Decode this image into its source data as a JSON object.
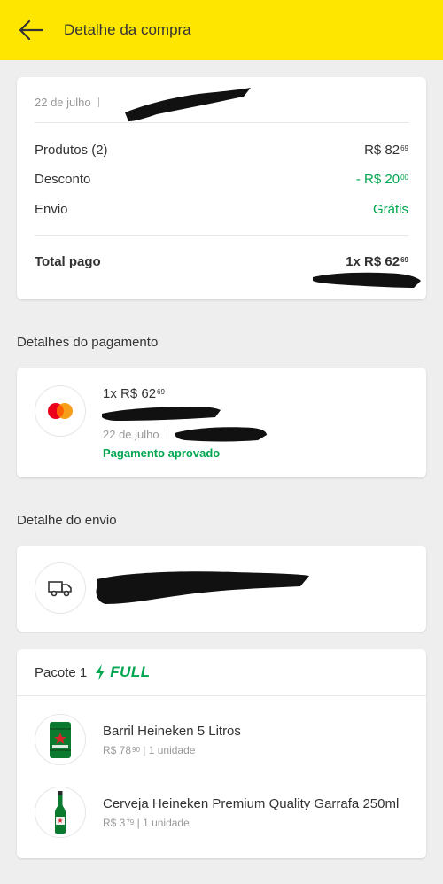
{
  "header": {
    "title": "Detalhe da compra",
    "back_icon": "arrow-left-icon"
  },
  "summary": {
    "date": "22 de julho",
    "rows": [
      {
        "label": "Produtos (2)",
        "amount": "R$ 82",
        "cents": "69"
      },
      {
        "label": "Desconto",
        "amount": "- R$ 20",
        "cents": "00"
      },
      {
        "label": "Envio",
        "amount": "Grátis",
        "cents": ""
      }
    ],
    "total_label": "Total pago",
    "total_amount": "1x R$ 62",
    "total_cents": "69"
  },
  "payment": {
    "section_title": "Detalhes do pagamento",
    "amount": "1x R$ 62",
    "cents": "69",
    "date": "22 de julho",
    "status": "Pagamento aprovado",
    "icon": "mastercard-icon"
  },
  "shipping": {
    "section_title": "Detalhe do envio",
    "icon": "truck-icon"
  },
  "package": {
    "title": "Pacote 1",
    "badge": "FULL",
    "items": [
      {
        "name": "Barril Heineken 5 Litros",
        "price": "R$ 78",
        "cents": "90",
        "qty": "1 unidade",
        "icon": "keg-icon"
      },
      {
        "name": "Cerveja Heineken Premium Quality Garrafa 250ml",
        "price": "R$ 3",
        "cents": "79",
        "qty": "1 unidade",
        "icon": "bottle-icon"
      }
    ]
  },
  "colors": {
    "header": "#ffe600",
    "green": "#00a650",
    "text": "#333333",
    "muted": "#999999"
  }
}
